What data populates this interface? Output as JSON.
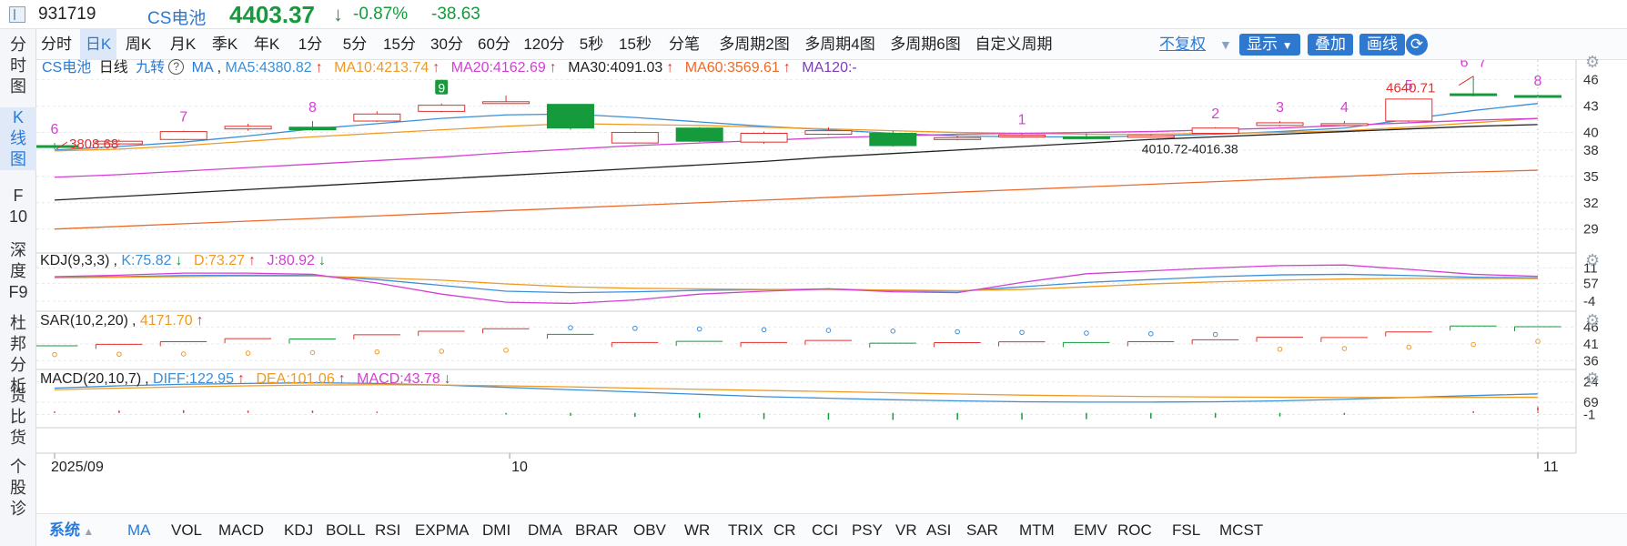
{
  "header": {
    "code": "931719",
    "name": "CS电池",
    "price": "4403.37",
    "change_pct": "-0.87%",
    "change": "-38.63"
  },
  "sidebar": {
    "items": [
      {
        "label": "分时图",
        "chars": [
          "分",
          "时",
          "图"
        ]
      },
      {
        "label": "K线图",
        "chars": [
          "K",
          "线",
          "图"
        ]
      },
      {
        "label": "F10",
        "chars": [
          "F",
          "10"
        ]
      },
      {
        "label": "深度F9",
        "chars": [
          "深",
          "度",
          "F9"
        ]
      },
      {
        "label": "杜邦分析",
        "chars": [
          "杜",
          "邦",
          "分",
          "析"
        ]
      },
      {
        "label": "货比货",
        "chars": [
          "货",
          "比",
          "货"
        ]
      },
      {
        "label": "个股",
        "chars": [
          "个",
          "股",
          "诊"
        ]
      }
    ]
  },
  "period_tabs": [
    "分时",
    "日K",
    "周K",
    "月K",
    "季K",
    "年K",
    "1分",
    "5分",
    "15分",
    "30分",
    "60分",
    "120分",
    "5秒",
    "15秒",
    "分笔",
    "多周期2图",
    "多周期4图",
    "多周期6图",
    "自定义周期"
  ],
  "period_active": "日K",
  "toolbar_right": {
    "adjust": "不复权",
    "display": "显示",
    "overlay": "叠加",
    "draw": "画线"
  },
  "main_legend": {
    "name": "CS电池",
    "period": "日线",
    "nine": "九转",
    "ma": "MA",
    "ma5": "MA5:4380.82",
    "ma10": "MA10:4213.74",
    "ma20": "MA20:4162.69",
    "ma30": "MA30:4091.03",
    "ma60": "MA60:3569.61",
    "ma120": "MA120:-",
    "up_arrow": "↑"
  },
  "kdj_legend": {
    "name": "KDJ(9,3,3)",
    "k": "K:75.82",
    "d": "D:73.27",
    "j": "J:80.92",
    "down": "↓",
    "up": "↑"
  },
  "sar_legend": {
    "name": "SAR(10,2,20)",
    "v": "4171.70",
    "up": "↑"
  },
  "macd_legend": {
    "name": "MACD(20,10,7)",
    "diff": "DIFF:122.95",
    "dea": "DEA:101.06",
    "macd": "MACD:43.78",
    "up": "↑",
    "down": "↓"
  },
  "colors": {
    "up": "#e0312d",
    "down": "#159a3c",
    "ma5": "#3d8fd8",
    "ma10": "#f09a24",
    "ma20": "#d43fd4",
    "ma30": "#222222",
    "ma60": "#ec6a2a",
    "ma120": "#7a3fb8",
    "accent": "#2a7ad6"
  },
  "chart_data": [
    {
      "type": "candlestick",
      "title": "CS电池 日线",
      "y_ticks": [
        "46",
        "43",
        "40",
        "38",
        "35",
        "32",
        "29"
      ],
      "x_ticks": [
        "2025/09",
        "10",
        "11"
      ],
      "annotations": [
        "3808.68",
        "4640.71",
        "4010.72-4016.38"
      ],
      "nine_turn_labels": [
        "6",
        "7",
        "8",
        "9",
        "1",
        "2",
        "3",
        "4",
        "5",
        "6",
        "7",
        "8"
      ],
      "candles": [
        {
          "o": 3850,
          "c": 3830,
          "h": 3880,
          "l": 3808.68
        },
        {
          "o": 3870,
          "c": 3900,
          "h": 3920,
          "l": 3860
        },
        {
          "o": 3920,
          "c": 4010,
          "h": 4020,
          "l": 3910
        },
        {
          "o": 4040,
          "c": 4070,
          "h": 4100,
          "l": 4020
        },
        {
          "o": 4060,
          "c": 4030,
          "h": 4130,
          "l": 4020
        },
        {
          "o": 4130,
          "c": 4210,
          "h": 4240,
          "l": 4120
        },
        {
          "o": 4240,
          "c": 4310,
          "h": 4330,
          "l": 4230
        },
        {
          "o": 4350,
          "c": 4350,
          "h": 4420,
          "l": 4330
        },
        {
          "o": 4320,
          "c": 4050,
          "h": 4320,
          "l": 4030
        },
        {
          "o": 3880,
          "c": 4000,
          "h": 4010,
          "l": 3870
        },
        {
          "o": 4050,
          "c": 3900,
          "h": 4060,
          "l": 3890
        },
        {
          "o": 3890,
          "c": 3990,
          "h": 4010,
          "l": 3870
        },
        {
          "o": 3980,
          "c": 4020,
          "h": 4060,
          "l": 3970
        },
        {
          "o": 3990,
          "c": 3850,
          "h": 4020,
          "l": 3840
        },
        {
          "o": 3930,
          "c": 3940,
          "h": 3960,
          "l": 3910
        },
        {
          "o": 3950,
          "c": 3970,
          "h": 3990,
          "l": 3940
        },
        {
          "o": 3950,
          "c": 3930,
          "h": 3990,
          "l": 3920
        },
        {
          "o": 3960,
          "c": 3965,
          "h": 3980,
          "l": 3940
        },
        {
          "o": 3990,
          "c": 4050,
          "h": 4060,
          "l": 3980
        },
        {
          "o": 4080,
          "c": 4110,
          "h": 4130,
          "l": 4070
        },
        {
          "o": 4080,
          "c": 4100,
          "h": 4130,
          "l": 4070
        },
        {
          "o": 4130,
          "c": 4380,
          "h": 4380,
          "l": 4120
        },
        {
          "o": 4440,
          "c": 4420,
          "h": 4640.71,
          "l": 4410
        },
        {
          "o": 4420,
          "c": 4403.37,
          "h": 4430,
          "l": 4390
        }
      ],
      "ma5": [
        3800,
        3840,
        3890,
        3960,
        4040,
        4100,
        4160,
        4200,
        4210,
        4170,
        4120,
        4070,
        4030,
        3990,
        3960,
        3950,
        3950,
        3960,
        3980,
        4010,
        4050,
        4150,
        4250,
        4330
      ],
      "ma10": [
        3790,
        3810,
        3850,
        3900,
        3950,
        3990,
        4030,
        4070,
        4100,
        4090,
        4080,
        4060,
        4040,
        4020,
        4000,
        3990,
        3980,
        3980,
        3990,
        4000,
        4020,
        4060,
        4110,
        4160
      ],
      "ma20": [
        3490,
        3520,
        3560,
        3600,
        3640,
        3680,
        3720,
        3770,
        3810,
        3850,
        3880,
        3910,
        3940,
        3960,
        3980,
        3990,
        4000,
        4010,
        4030,
        4050,
        4080,
        4110,
        4140,
        4160
      ],
      "ma30": [
        3230,
        3270,
        3310,
        3350,
        3390,
        3430,
        3470,
        3510,
        3550,
        3590,
        3630,
        3670,
        3720,
        3760,
        3800,
        3840,
        3880,
        3920,
        3950,
        3980,
        4010,
        4040,
        4070,
        4090
      ],
      "ma60": [
        2900,
        2930,
        2960,
        2990,
        3020,
        3050,
        3080,
        3110,
        3140,
        3170,
        3200,
        3230,
        3260,
        3290,
        3320,
        3350,
        3380,
        3410,
        3440,
        3470,
        3500,
        3530,
        3550,
        3569.61
      ]
    },
    {
      "type": "line",
      "title": "KDJ(9,3,3)",
      "y_ticks": [
        "11",
        "57",
        "-4"
      ],
      "k": [
        78,
        80,
        84,
        85,
        84,
        70,
        50,
        30,
        25,
        28,
        33,
        35,
        38,
        32,
        30,
        45,
        60,
        70,
        80,
        86,
        88,
        84,
        78,
        75.82
      ],
      "d": [
        76,
        78,
        80,
        82,
        82,
        76,
        68,
        55,
        45,
        40,
        38,
        36,
        36,
        34,
        32,
        36,
        45,
        55,
        62,
        68,
        72,
        74,
        74,
        73.27
      ],
      "j": [
        80,
        85,
        92,
        92,
        88,
        58,
        20,
        -8,
        -12,
        0,
        20,
        30,
        38,
        28,
        25,
        60,
        90,
        100,
        110,
        118,
        120,
        105,
        88,
        80.92
      ]
    },
    {
      "type": "scatter",
      "title": "SAR(10,2,20)",
      "y_ticks": [
        "46",
        "41",
        "36"
      ],
      "sar": [
        3780,
        3790,
        3800,
        3820,
        3840,
        3860,
        3880,
        3910,
        4580,
        4560,
        4540,
        4520,
        4500,
        4480,
        4460,
        4440,
        4420,
        4400,
        4380,
        3940,
        3960,
        4000,
        4080,
        4171.7
      ]
    },
    {
      "type": "bar",
      "title": "MACD(20,10,7)",
      "y_ticks": [
        "24",
        "69",
        "-1"
      ],
      "diff": [
        160,
        175,
        185,
        190,
        195,
        190,
        180,
        165,
        150,
        135,
        120,
        105,
        95,
        85,
        78,
        72,
        70,
        70,
        72,
        78,
        88,
        100,
        112,
        122.95
      ],
      "dea": [
        150,
        160,
        168,
        175,
        180,
        182,
        180,
        175,
        168,
        160,
        152,
        145,
        138,
        130,
        122,
        115,
        110,
        106,
        103,
        101,
        100,
        100,
        101,
        101.06
      ],
      "macd": [
        10,
        15,
        17,
        15,
        15,
        8,
        0,
        -10,
        -18,
        -25,
        -32,
        -40,
        -43,
        -45,
        -44,
        -43,
        -40,
        -36,
        -31,
        -23,
        -12,
        0,
        11,
        43.78
      ]
    }
  ],
  "indicators": [
    "系统",
    "MA",
    "VOL",
    "MACD",
    "KDJ",
    "BOLL",
    "RSI",
    "EXPMA",
    "DMI",
    "DMA",
    "BRAR",
    "OBV",
    "WR",
    "TRIX",
    "CR",
    "CCI",
    "PSY",
    "VR",
    "ASI",
    "SAR",
    "MTM",
    "EMV",
    "ROC",
    "FSL",
    "MCST"
  ],
  "indicator_active": "MA"
}
